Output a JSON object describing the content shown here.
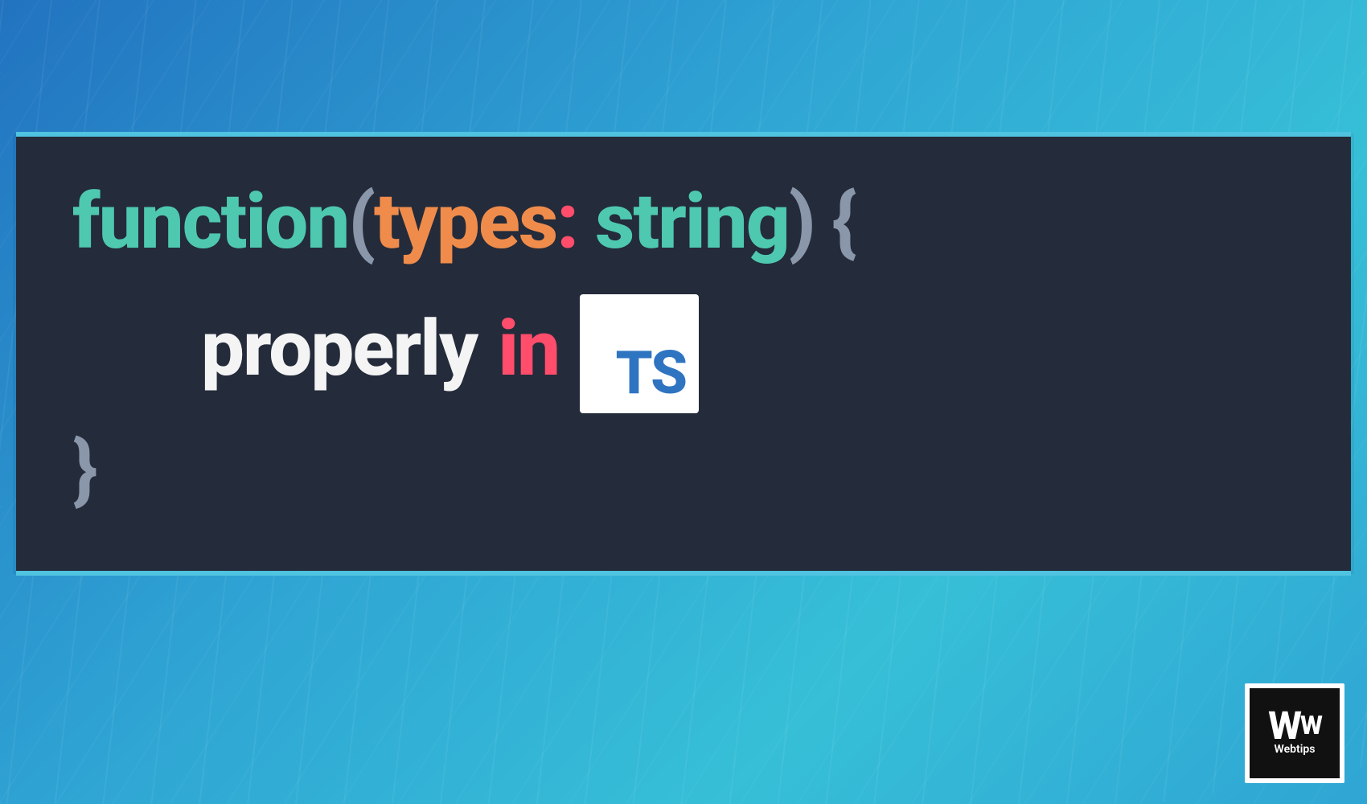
{
  "code": {
    "function_kw": "function",
    "paren_open": "(",
    "arg_name": "types",
    "colon": ":",
    "arg_type": " string",
    "paren_close": ")",
    "brace_open": " {",
    "word_properly": "properly",
    "word_in": "in",
    "brace_close": "}"
  },
  "ts_badge": {
    "label": "TS"
  },
  "watermark": {
    "logo_big": "W",
    "logo_small": "W",
    "label": "Webtips"
  }
}
